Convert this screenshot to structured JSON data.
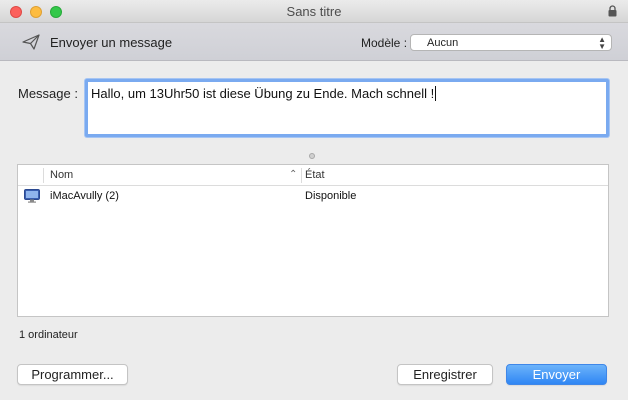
{
  "window": {
    "title": "Sans titre"
  },
  "toolbar": {
    "action_label": "Envoyer un message",
    "model_label": "Modèle :",
    "model_value": "Aucun"
  },
  "message": {
    "label": "Message :",
    "value": "Hallo, um 13Uhr50 ist diese Übung zu Ende. Mach schnell !"
  },
  "table": {
    "columns": [
      "Nom",
      "État"
    ],
    "rows": [
      {
        "name": "iMacAvully (2)",
        "state": "Disponible",
        "icon": "computer-icon"
      }
    ]
  },
  "status": {
    "count": "1 ordinateur"
  },
  "buttons": {
    "schedule": "Programmer...",
    "save": "Enregistrer",
    "send": "Envoyer"
  },
  "colors": {
    "accent": "#2f86f4",
    "focus_ring": "#7aaaf0"
  }
}
